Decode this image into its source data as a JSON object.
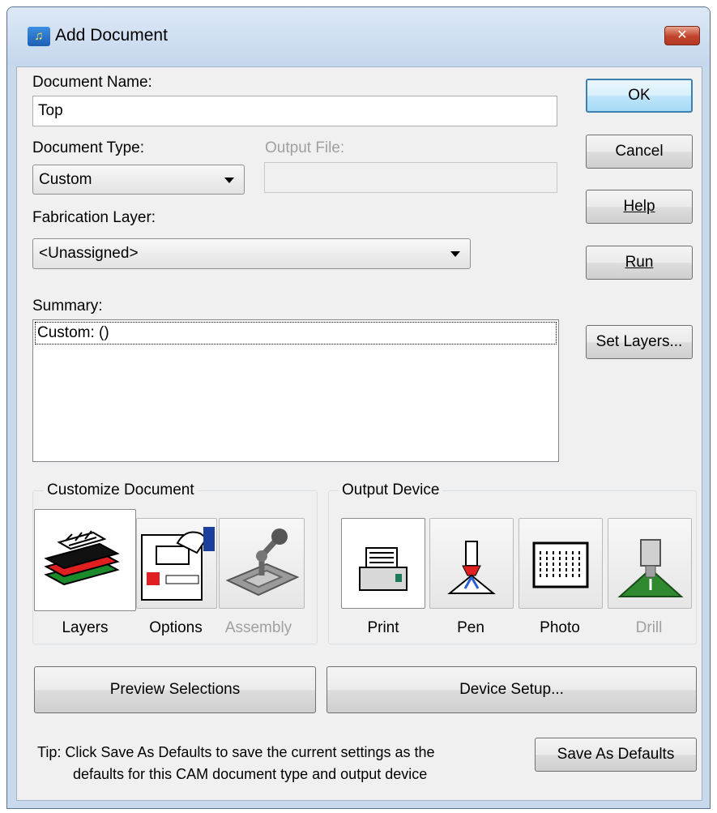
{
  "window": {
    "title": "Add Document",
    "close_symbol": "✕"
  },
  "labels": {
    "document_name": "Document Name:",
    "document_type": "Document Type:",
    "output_file": "Output File:",
    "fabrication_layer": "Fabrication Layer:",
    "summary": "Summary:"
  },
  "fields": {
    "document_name_value": "Top",
    "document_type_value": "Custom",
    "output_file_value": "",
    "fabrication_layer_value": "<Unassigned>",
    "summary_value": "Custom: ()"
  },
  "buttons": {
    "ok": "OK",
    "cancel": "Cancel",
    "help": "Help",
    "run": "Run",
    "set_layers": "Set Layers...",
    "preview_selections": "Preview Selections",
    "device_setup": "Device Setup...",
    "save_as_defaults": "Save As Defaults"
  },
  "customize": {
    "title": "Customize Document",
    "items": [
      {
        "label": "Layers",
        "icon": "layers-icon",
        "selected": true
      },
      {
        "label": "Options",
        "icon": "options-icon"
      },
      {
        "label": "Assembly",
        "icon": "assembly-icon",
        "disabled": true
      }
    ]
  },
  "output_device": {
    "title": "Output Device",
    "items": [
      {
        "label": "Print",
        "icon": "printer-icon",
        "selected": true
      },
      {
        "label": "Pen",
        "icon": "pen-plotter-icon"
      },
      {
        "label": "Photo",
        "icon": "photo-plotter-icon"
      },
      {
        "label": "Drill",
        "icon": "drill-icon",
        "disabled": true
      }
    ]
  },
  "tip": {
    "line1": "Tip: Click Save As Defaults to save the current settings as the",
    "line2": "defaults for this CAM document type and output device"
  },
  "colors": {
    "highlight": "#e0252a",
    "default_button_border": "#3c7fb1"
  }
}
